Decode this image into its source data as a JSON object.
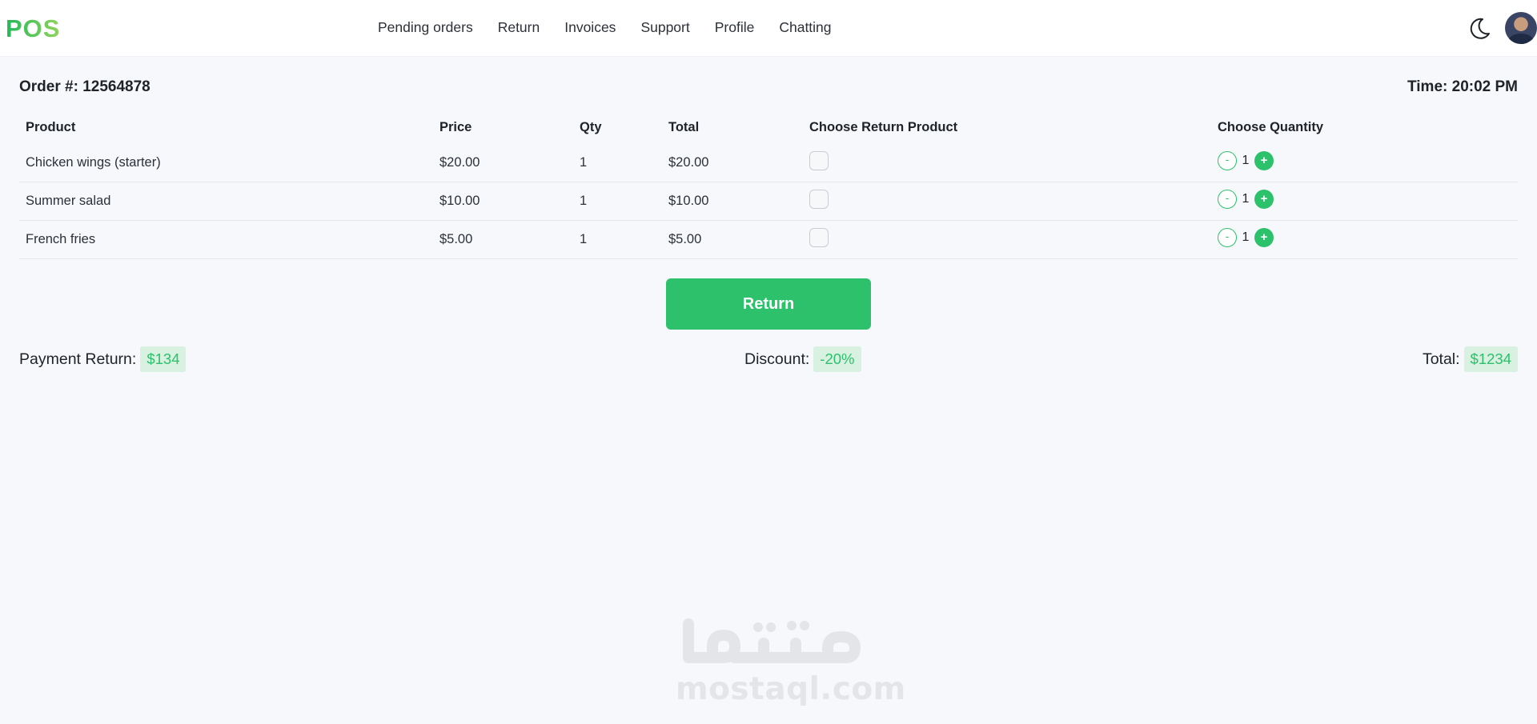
{
  "app": {
    "logo": "POS"
  },
  "nav": {
    "links": [
      "Pending orders",
      "Return",
      "Invoices",
      "Support",
      "Profile",
      "Chatting"
    ],
    "theme_icon": "moon-icon",
    "avatar_icon": "user-avatar"
  },
  "order": {
    "number_label": "Order #: 12564878",
    "time_label": "Time: 20:02 PM"
  },
  "table": {
    "headers": [
      "Product",
      "Price",
      "Qty",
      "Total",
      "Choose Return Product",
      "Choose Quantity"
    ],
    "rows": [
      {
        "product": "Chicken wings (starter)",
        "price": "$20.00",
        "qty": "1",
        "total": "$20.00",
        "selected": false,
        "choose_qty": "1"
      },
      {
        "product": "Summer salad",
        "price": "$10.00",
        "qty": "1",
        "total": "$10.00",
        "selected": false,
        "choose_qty": "1"
      },
      {
        "product": "French fries",
        "price": "$5.00",
        "qty": "1",
        "total": "$5.00",
        "selected": false,
        "choose_qty": "1"
      }
    ],
    "stepper": {
      "minus": "-",
      "plus": "+"
    }
  },
  "actions": {
    "return_label": "Return"
  },
  "summary": {
    "payment_label": "Payment Return:",
    "payment_value": "$134",
    "discount_label": "Discount:",
    "discount_value": "-20%",
    "total_label": "Total:",
    "total_value": "$1234"
  },
  "watermark": {
    "text": "mostaql.com",
    "logo_text": "مستقل"
  },
  "colors": {
    "accent": "#2cc16a",
    "accent_light": "#d8f1e1",
    "background": "#f6f8fb",
    "watermark": "#e3e5e8"
  }
}
